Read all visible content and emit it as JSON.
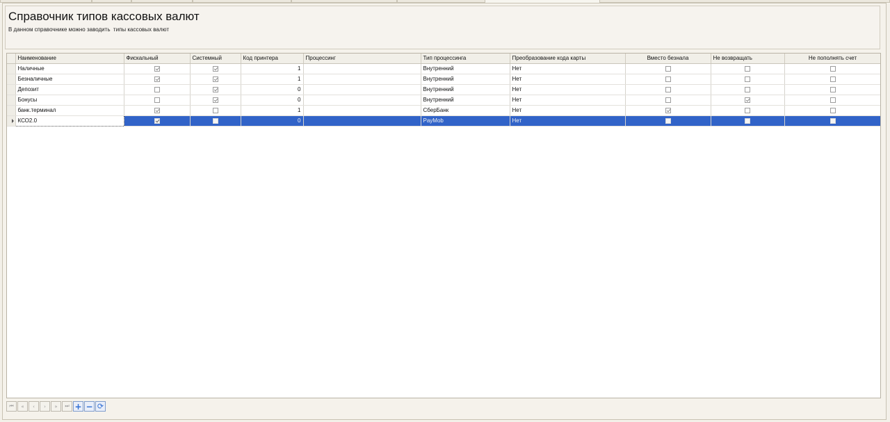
{
  "header": {
    "title": "Справочник типов кассовых валют",
    "subtitle": "В данном справочнике можно заводить  типы кассовых валют"
  },
  "grid": {
    "columns": [
      "Наименование",
      "Фискальный",
      "Системный",
      "Код принтера",
      "Процессинг",
      "Тип процессинга",
      "Преобразование кода карты",
      "Вместо безнала",
      "Не возвращать",
      "Не пополнять счет"
    ],
    "rows": [
      {
        "name": "Наличные",
        "fiscal": true,
        "system": true,
        "printer_code": "1",
        "processing": "",
        "processing_type": "Внутренний",
        "card_conversion": "Нет",
        "instead_cashless": false,
        "no_return": false,
        "no_topup": false
      },
      {
        "name": "Безналичные",
        "fiscal": true,
        "system": true,
        "printer_code": "1",
        "processing": "",
        "processing_type": "Внутренний",
        "card_conversion": "Нет",
        "instead_cashless": false,
        "no_return": false,
        "no_topup": false
      },
      {
        "name": "Депозит",
        "fiscal": false,
        "system": true,
        "printer_code": "0",
        "processing": "",
        "processing_type": "Внутренний",
        "card_conversion": "Нет",
        "instead_cashless": false,
        "no_return": false,
        "no_topup": false
      },
      {
        "name": "Бонусы",
        "fiscal": false,
        "system": true,
        "printer_code": "0",
        "processing": "",
        "processing_type": "Внутренний",
        "card_conversion": "Нет",
        "instead_cashless": false,
        "no_return": true,
        "no_topup": false
      },
      {
        "name": "банк.терминал",
        "fiscal": true,
        "system": false,
        "printer_code": "1",
        "processing": "",
        "processing_type": "СберБанк",
        "card_conversion": "Нет",
        "instead_cashless": true,
        "no_return": false,
        "no_topup": false
      },
      {
        "name": "КСО2.0",
        "fiscal": true,
        "system": false,
        "printer_code": "0",
        "processing": "",
        "processing_type": "PayMob",
        "card_conversion": "Нет",
        "instead_cashless": false,
        "no_return": false,
        "no_topup": false,
        "selected": true
      }
    ]
  },
  "navigator": {
    "buttons": [
      {
        "name": "first-record",
        "icon": "first-icon",
        "glyph": "⏮"
      },
      {
        "name": "prior-page",
        "icon": "prior-page-icon",
        "glyph": "«"
      },
      {
        "name": "prior-record",
        "icon": "prior-icon",
        "glyph": "‹"
      },
      {
        "name": "next-record",
        "icon": "next-icon",
        "glyph": "›"
      },
      {
        "name": "next-page",
        "icon": "next-page-icon",
        "glyph": "»"
      },
      {
        "name": "last-record",
        "icon": "last-icon",
        "glyph": "⏭"
      },
      {
        "name": "insert-record",
        "icon": "plus-icon",
        "glyph": "+"
      },
      {
        "name": "delete-record",
        "icon": "minus-icon",
        "glyph": "−"
      },
      {
        "name": "refresh-data",
        "icon": "refresh-icon",
        "glyph": "⟳"
      }
    ]
  },
  "colors": {
    "selection": "#3163c8",
    "background": "#f3f0e9"
  }
}
